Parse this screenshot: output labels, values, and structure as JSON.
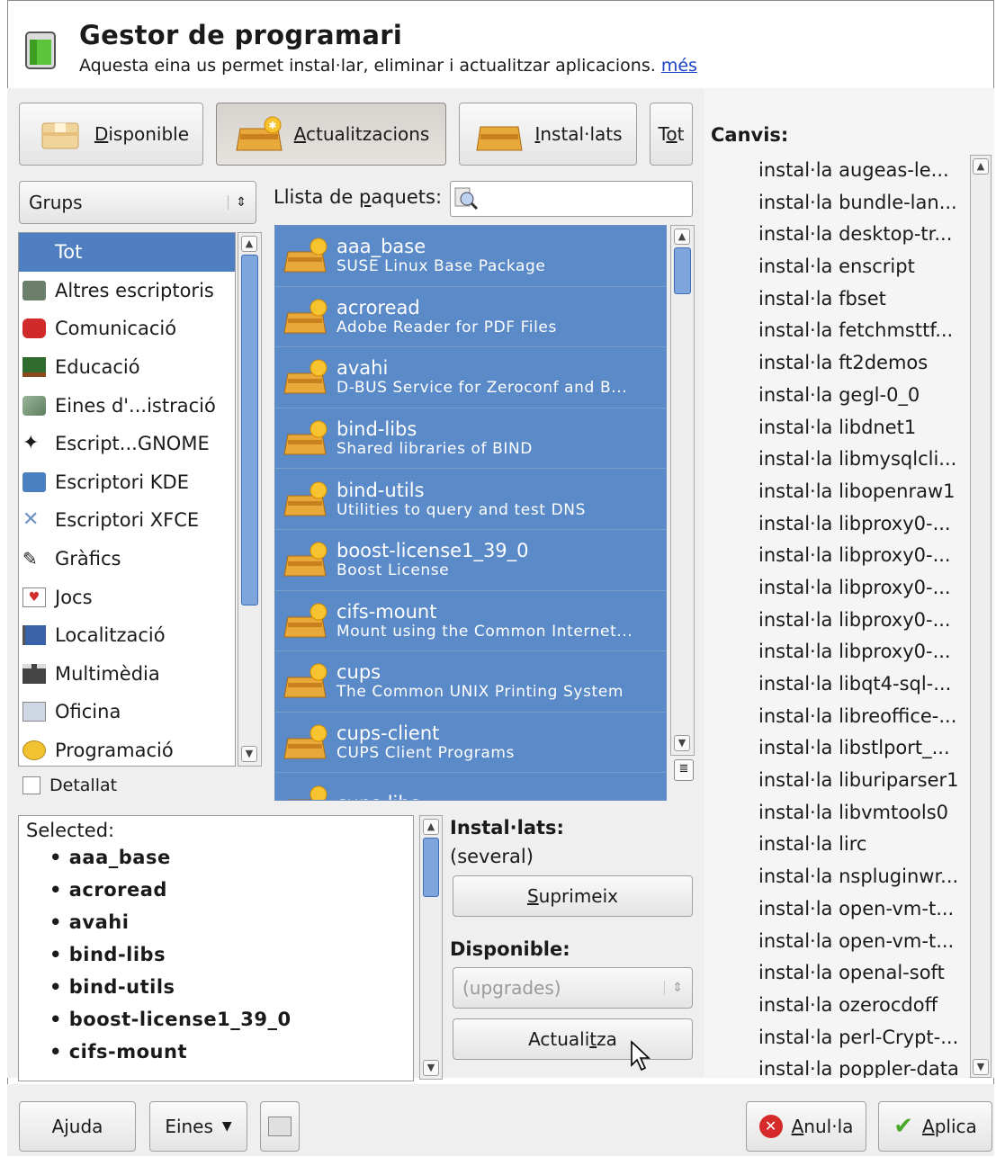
{
  "header": {
    "title": "Gestor de programari",
    "subtitle": "Aquesta eina us permet instal·lar, eliminar i actualitzar aplicacions.",
    "more_link": "més"
  },
  "view_buttons": [
    {
      "label": "Disponible",
      "underline": "D",
      "rest": "isponible",
      "icon": "box-icon",
      "pressed": false
    },
    {
      "label": "Actualitzacions",
      "underline": "A",
      "rest": "ctualitzacions",
      "icon": "box-update-icon",
      "pressed": true
    },
    {
      "label": "Instal·lats",
      "underline": "I",
      "rest": "nstal·lats",
      "icon": "box-installed-icon",
      "pressed": false
    },
    {
      "label": "Tot",
      "pre": "T",
      "underline": "o",
      "rest": "t",
      "pressed": false
    }
  ],
  "groups_combo": {
    "value": "Grups"
  },
  "groups": [
    {
      "label": "Tot",
      "icon": "none",
      "selected": true
    },
    {
      "label": "Altres escriptoris",
      "icon": "desktop-icon"
    },
    {
      "label": "Comunicació",
      "icon": "phone-icon"
    },
    {
      "label": "Educació",
      "icon": "education-icon"
    },
    {
      "label": "Eines d'...istració",
      "icon": "admin-tools-icon"
    },
    {
      "label": "Escript...GNOME",
      "icon": "gnome-foot-icon"
    },
    {
      "label": "Escriptori KDE",
      "icon": "kde-icon"
    },
    {
      "label": "Escriptori XFCE",
      "icon": "xfce-icon"
    },
    {
      "label": "Gràfics",
      "icon": "brush-icon"
    },
    {
      "label": "Jocs",
      "icon": "cards-icon"
    },
    {
      "label": "Localització",
      "icon": "flag-icon"
    },
    {
      "label": "Multimèdia",
      "icon": "film-icon"
    },
    {
      "label": "Oficina",
      "icon": "office-icon"
    },
    {
      "label": "Programació",
      "icon": "programming-icon"
    }
  ],
  "detailed_checkbox": {
    "label": "Detallat",
    "checked": false
  },
  "package_search": {
    "label": "Llista de paquets:",
    "underline": "p",
    "value": ""
  },
  "packages": [
    {
      "name": "aaa_base",
      "desc": "SUSE Linux Base Package"
    },
    {
      "name": "acroread",
      "desc": "Adobe Reader for PDF Files"
    },
    {
      "name": "avahi",
      "desc": "D-BUS Service for Zeroconf and B..."
    },
    {
      "name": "bind-libs",
      "desc": "Shared libraries of BIND"
    },
    {
      "name": "bind-utils",
      "desc": "Utilities to query and test DNS"
    },
    {
      "name": "boost-license1_39_0",
      "desc": "Boost License"
    },
    {
      "name": "cifs-mount",
      "desc": "Mount using the Common Internet..."
    },
    {
      "name": "cups",
      "desc": "The Common UNIX Printing System"
    },
    {
      "name": "cups-client",
      "desc": "CUPS Client Programs"
    },
    {
      "name": "cups-libs",
      "desc": ""
    }
  ],
  "selected_panel": {
    "header": "Selected:",
    "items": [
      "aaa_base",
      "acroread",
      "avahi",
      "bind-libs",
      "bind-utils",
      "boost-license1_39_0",
      "cifs-mount"
    ]
  },
  "actions": {
    "installed_label": "Instal·lats:",
    "installed_value": "(several)",
    "remove_button": "Suprimeix",
    "available_label": "Disponible:",
    "available_combo": "(upgrades)",
    "update_button": "Actualitza"
  },
  "changes": {
    "title": "Canvis:",
    "items": [
      "instal·la augeas-le...",
      "instal·la bundle-lan...",
      "instal·la desktop-tr...",
      "instal·la enscript",
      "instal·la fbset",
      "instal·la fetchmsttf...",
      "instal·la ft2demos",
      "instal·la gegl-0_0",
      "instal·la libdnet1",
      "instal·la libmysqlcli...",
      "instal·la libopenraw1",
      "instal·la libproxy0-...",
      "instal·la libproxy0-...",
      "instal·la libproxy0-...",
      "instal·la libproxy0-...",
      "instal·la libproxy0-...",
      "instal·la libqt4-sql-...",
      "instal·la libreoffice-...",
      "instal·la libstlport_...",
      "instal·la liburiparser1",
      "instal·la libvmtools0",
      "instal·la lirc",
      "instal·la nspluginwr...",
      "instal·la open-vm-t...",
      "instal·la open-vm-t...",
      "instal·la openal-soft",
      "instal·la ozerocdoff",
      "instal·la perl-Crypt-...",
      "instal·la poppler-data"
    ]
  },
  "footer": {
    "help_button": "Ajuda",
    "tools_button": "Eines",
    "cancel_button": "Anul·la",
    "apply_button": "Aplica"
  },
  "colors": {
    "selection": "#5b8ac8",
    "selection_dark": "#4f7fc0",
    "pane_bg": "#efefef",
    "link": "#1a43c8"
  }
}
